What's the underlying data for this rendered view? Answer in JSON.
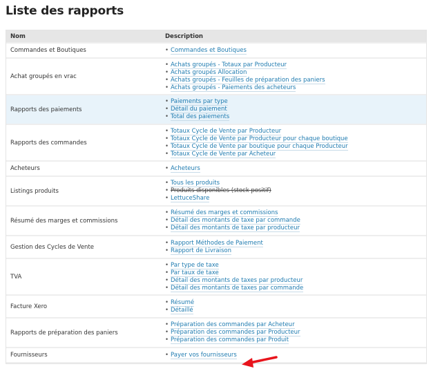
{
  "page": {
    "title": "Liste des rapports"
  },
  "table": {
    "headers": {
      "name": "Nom",
      "description": "Description"
    },
    "rows": [
      {
        "name": "Commandes et Boutiques",
        "links": [
          {
            "label": "Commandes et Boutiques"
          }
        ]
      },
      {
        "name": "Achat groupés en vrac",
        "links": [
          {
            "label": "Achats groupés - Totaux par Producteur"
          },
          {
            "label": "Achats groupés Allocation"
          },
          {
            "label": "Achats groupés - Feuilles de préparation des paniers"
          },
          {
            "label": "Achats groupés - Paiements des acheteurs"
          }
        ]
      },
      {
        "name": "Rapports des paiements",
        "links": [
          {
            "label": "Paiements par type"
          },
          {
            "label": "Détail du paiement"
          },
          {
            "label": "Total des paiements"
          }
        ]
      },
      {
        "name": "Rapports des commandes",
        "links": [
          {
            "label": "Totaux Cycle de Vente par Producteur"
          },
          {
            "label": "Totaux Cycle de Vente par Producteur pour chaque boutique"
          },
          {
            "label": "Totaux Cycle de Vente par boutique pour chaque Producteur"
          },
          {
            "label": "Totaux Cycle de Vente par Acheteur"
          }
        ]
      },
      {
        "name": "Acheteurs",
        "links": [
          {
            "label": "Acheteurs"
          }
        ]
      },
      {
        "name": "Listings produits",
        "links": [
          {
            "label": "Tous les produits"
          },
          {
            "label": "Produits disponibles (stock positif)"
          },
          {
            "label": "LettuceShare"
          }
        ]
      },
      {
        "name": "Résumé des marges et commissions",
        "links": [
          {
            "label": "Résumé des marges et commissions"
          },
          {
            "label": "Détail des montants de taxe par commande"
          },
          {
            "label": "Détail des montants de taxe par producteur"
          }
        ]
      },
      {
        "name": "Gestion des Cycles de Vente",
        "links": [
          {
            "label": "Rapport Méthodes de Paiement"
          },
          {
            "label": "Rapport de Livraison"
          }
        ]
      },
      {
        "name": "TVA",
        "links": [
          {
            "label": "Par type de taxe"
          },
          {
            "label": "Par taux de taxe"
          },
          {
            "label": "Détail des montants de taxes par producteur"
          },
          {
            "label": "Détail des montants de taxes par commande"
          }
        ]
      },
      {
        "name": "Facture Xero",
        "links": [
          {
            "label": "Résumé"
          },
          {
            "label": "Détaillé"
          }
        ]
      },
      {
        "name": "Rapports de préparation des paniers",
        "links": [
          {
            "label": "Préparation des commandes par Acheteur"
          },
          {
            "label": "Préparation des commandes par Producteur"
          },
          {
            "label": "Préparation des commandes par Produit"
          }
        ]
      },
      {
        "name": "Fournisseurs",
        "links": [
          {
            "label": "Payer vos fournisseurs"
          }
        ]
      }
    ]
  },
  "colors": {
    "link": "#1f7bb0",
    "header_bg": "#e6e6e6",
    "highlight_row_bg": "#e8f3fa",
    "annotation_arrow": "#e8141c"
  },
  "annotation": {
    "icon": "red-arrow-icon",
    "points_to": "Payer vos fournisseurs"
  }
}
